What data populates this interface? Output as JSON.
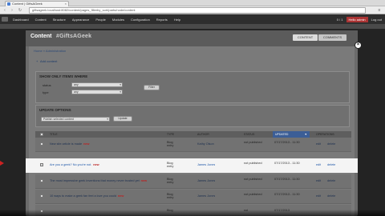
{
  "browser": {
    "tab_title": "Content | GiftsAGeek",
    "url": "giftsageek.localhost:8082/content/pages_filterby_sort/parts/node/content",
    "back": "‹",
    "forward": "›",
    "reload": "↻",
    "menu": "≡"
  },
  "admin_bar": {
    "items": [
      "Dashboard",
      "Content",
      "Structure",
      "Appearance",
      "People",
      "Modules",
      "Configuration",
      "Reports",
      "Help"
    ],
    "hello": "Hello admin",
    "count": "0 / 1",
    "logout": "Log out"
  },
  "modal": {
    "title": "Content",
    "subtitle": "#GiftsAGeek",
    "tabs": [
      "CONTENT",
      "COMMENTS"
    ],
    "close": "×",
    "breadcrumb": "Home » Administration",
    "add_link": "Add content",
    "filter": {
      "legend": "SHOW ONLY ITEMS WHERE",
      "status_label": "status",
      "status_value": "any",
      "type_label": "type",
      "type_value": "any",
      "filter_button": "Filter"
    },
    "update": {
      "legend": "UPDATE OPTIONS",
      "action_value": "Publish selected content",
      "update_button": "Update"
    },
    "table": {
      "headers": [
        "TITLE",
        "TYPE",
        "AUTHOR",
        "STATUS",
        "UPDATED",
        "OPERATIONS"
      ],
      "sort_icon": "▼",
      "rows": [
        {
          "title": "New site article is made",
          "new": "new",
          "type": "Blog entry",
          "author": "Kathy Olson",
          "status": "not published",
          "updated": "07/17/2013 - 11:30",
          "edit": "edit",
          "delete": "delete"
        },
        {
          "title": "Are you a geek? No you're not.",
          "new": "new",
          "type": "Blog entry",
          "author": "James Jones",
          "status": "not published",
          "updated": "07/17/2013 - 11:30",
          "edit": "edit",
          "delete": "delete"
        },
        {
          "title": "The most impressive geek inventions that money never trusted yet",
          "new": "new",
          "type": "Blog entry",
          "author": "James Jones",
          "status": "not published",
          "updated": "07/17/2013 - 11:30",
          "edit": "edit",
          "delete": "delete"
        },
        {
          "title": "10 ways to make a geek fan feel a love you could",
          "new": "new",
          "type": "Blog entry",
          "author": "James Jones",
          "status": "not published",
          "updated": "07/17/2013 - 11:30",
          "edit": "edit",
          "delete": "delete"
        },
        {
          "title": "",
          "new": "",
          "type": "Blog",
          "author": "",
          "status": "not",
          "updated": "07/17/2013",
          "edit": "",
          "delete": ""
        }
      ]
    }
  },
  "colors": {
    "admin_bar": "#2e2e2e",
    "hello_badge": "#aa3333",
    "updated_header": "#3c5e96",
    "new_marker": "#bb2222",
    "pointer_arrow": "#cc2222"
  }
}
